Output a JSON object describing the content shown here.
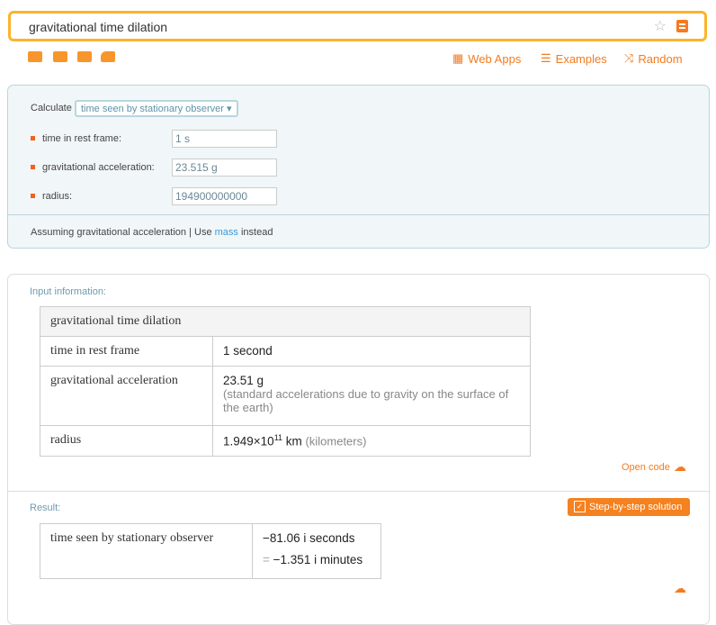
{
  "search": {
    "query": "gravitational time dilation"
  },
  "nav": {
    "web_apps": "Web Apps",
    "examples": "Examples",
    "random": "Random"
  },
  "form": {
    "calculate_label": "Calculate",
    "calculate_value": "time seen by stationary observer ▾",
    "fields": [
      {
        "label": "time in rest frame:",
        "value": "1 s"
      },
      {
        "label": "gravitational acceleration:",
        "value": "23.515 g"
      },
      {
        "label": "radius:",
        "value": "194900000000"
      }
    ],
    "assuming_prefix": "Assuming gravitational acceleration | Use ",
    "assuming_link": "mass",
    "assuming_suffix": " instead"
  },
  "input": {
    "label": "Input information:",
    "header": "gravitational time dilation",
    "rows": [
      {
        "name": "time in rest frame",
        "value": "1 second",
        "note": ""
      },
      {
        "name": "gravitational acceleration",
        "value": "23.51 g",
        "note": "(standard accelerations due to gravity on the surface of the earth)"
      },
      {
        "name": "radius",
        "value": "1.949×10",
        "exp": "11",
        "unit": " km",
        "note": "(kilometers)"
      }
    ],
    "open_code": "Open code"
  },
  "result": {
    "label": "Result:",
    "step_button": "Step-by-step solution",
    "name": "time seen by stationary observer",
    "value1": "−81.06 i seconds",
    "value2": "−1.351 i minutes",
    "eq": "="
  },
  "colors": {
    "accent": "#f47b20",
    "search_border": "#fbb42c",
    "panel_bg": "#f1f6f8"
  }
}
